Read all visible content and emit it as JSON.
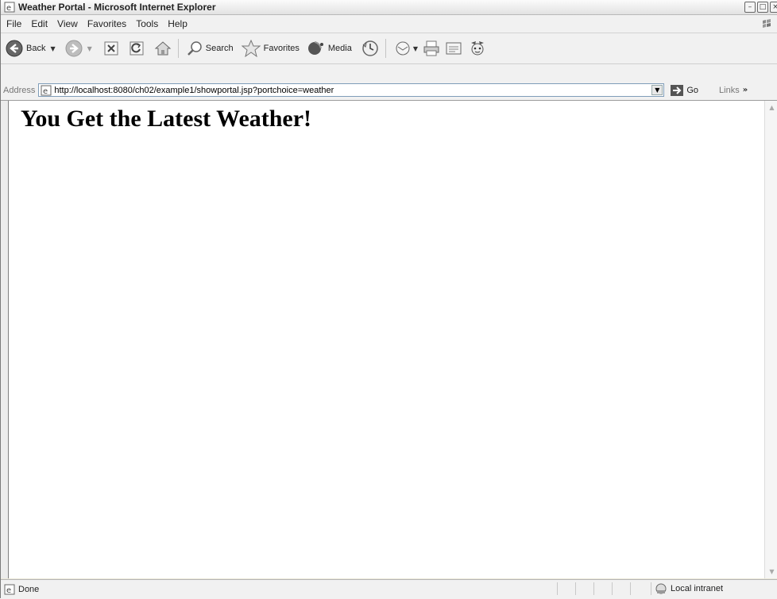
{
  "window": {
    "title": "Weather Portal - Microsoft Internet Explorer"
  },
  "menubar": {
    "items": [
      "File",
      "Edit",
      "View",
      "Favorites",
      "Tools",
      "Help"
    ]
  },
  "toolbar": {
    "back_label": "Back",
    "search_label": "Search",
    "favorites_label": "Favorites",
    "media_label": "Media"
  },
  "addressbar": {
    "label": "Address",
    "url": "http://localhost:8080/ch02/example1/showportal.jsp?portchoice=weather",
    "go_label": "Go",
    "links_label": "Links",
    "links_more": "»"
  },
  "page": {
    "heading": "You Get the Latest Weather!"
  },
  "statusbar": {
    "status": "Done",
    "zone": "Local intranet"
  },
  "icons": [
    "ie-page-icon",
    "windows-logo-icon",
    "back-arrow-icon",
    "forward-arrow-icon",
    "stop-icon",
    "refresh-icon",
    "home-icon",
    "search-icon",
    "favorites-star-icon",
    "media-icon",
    "history-icon",
    "mail-icon",
    "print-icon",
    "edit-icon",
    "messenger-icon",
    "go-arrow-icon",
    "intranet-icon"
  ]
}
